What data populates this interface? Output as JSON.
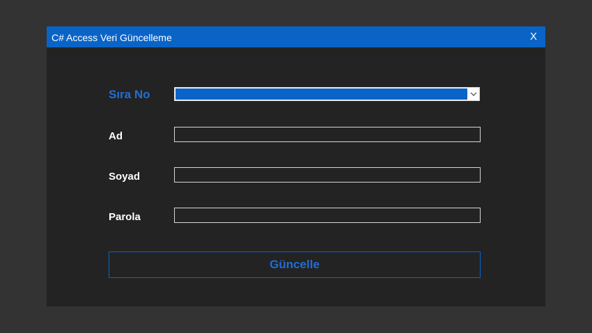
{
  "window": {
    "title": "C# Access Veri Güncelleme",
    "close_label": "X"
  },
  "form": {
    "sira_no_label": "Sıra No",
    "sira_no_value": "",
    "ad_label": "Ad",
    "ad_value": "",
    "soyad_label": "Soyad",
    "soyad_value": "",
    "parola_label": "Parola",
    "parola_value": ""
  },
  "actions": {
    "update_label": "Güncelle"
  },
  "icons": {
    "combo_arrow": "chevron-down-icon"
  },
  "colors": {
    "accent": "#0a64c8",
    "accent_text": "#1f6fd6",
    "window_bg": "#232323",
    "desktop_bg": "#333333"
  }
}
